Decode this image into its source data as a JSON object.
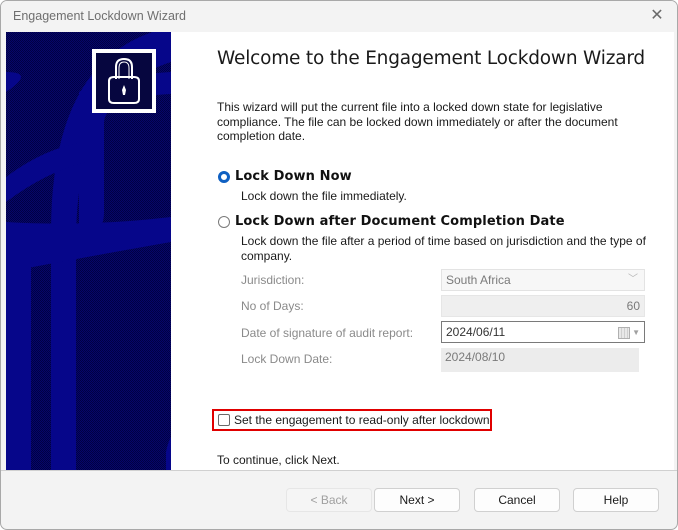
{
  "window": {
    "title": "Engagement Lockdown Wizard",
    "close_icon": "close-icon"
  },
  "banner": {
    "icon": "padlock-icon",
    "background_color": "#06066a"
  },
  "main": {
    "heading": "Welcome to the Engagement Lockdown Wizard",
    "intro": "This wizard will put the current file into a locked down state for legislative compliance. The file can be locked down immediately or after the document completion date.",
    "options": [
      {
        "label": "Lock Down Now",
        "description": "Lock down the file immediately.",
        "selected": true
      },
      {
        "label": "Lock Down after Document Completion Date",
        "description": "Lock down the file after a period of time based on jurisdiction and the type of company.",
        "selected": false
      }
    ],
    "fields": {
      "jurisdiction": {
        "label": "Jurisdiction:",
        "value": "South Africa"
      },
      "days": {
        "label": "No of Days:",
        "value": "60"
      },
      "signature_date": {
        "label": "Date of signature of audit report:",
        "value": "2024/06/11"
      },
      "lockdown_date": {
        "label": "Lock Down Date:",
        "value": "2024/08/10"
      }
    },
    "readonly_checkbox": {
      "label": "Set the engagement to read-only after lockdown",
      "checked": false
    },
    "continue_text": "To continue, click Next."
  },
  "buttons": {
    "back": "< Back",
    "next": "Next >",
    "cancel": "Cancel",
    "help": "Help"
  },
  "colors": {
    "accent": "#0f60c2",
    "highlight_frame": "#e00000"
  }
}
